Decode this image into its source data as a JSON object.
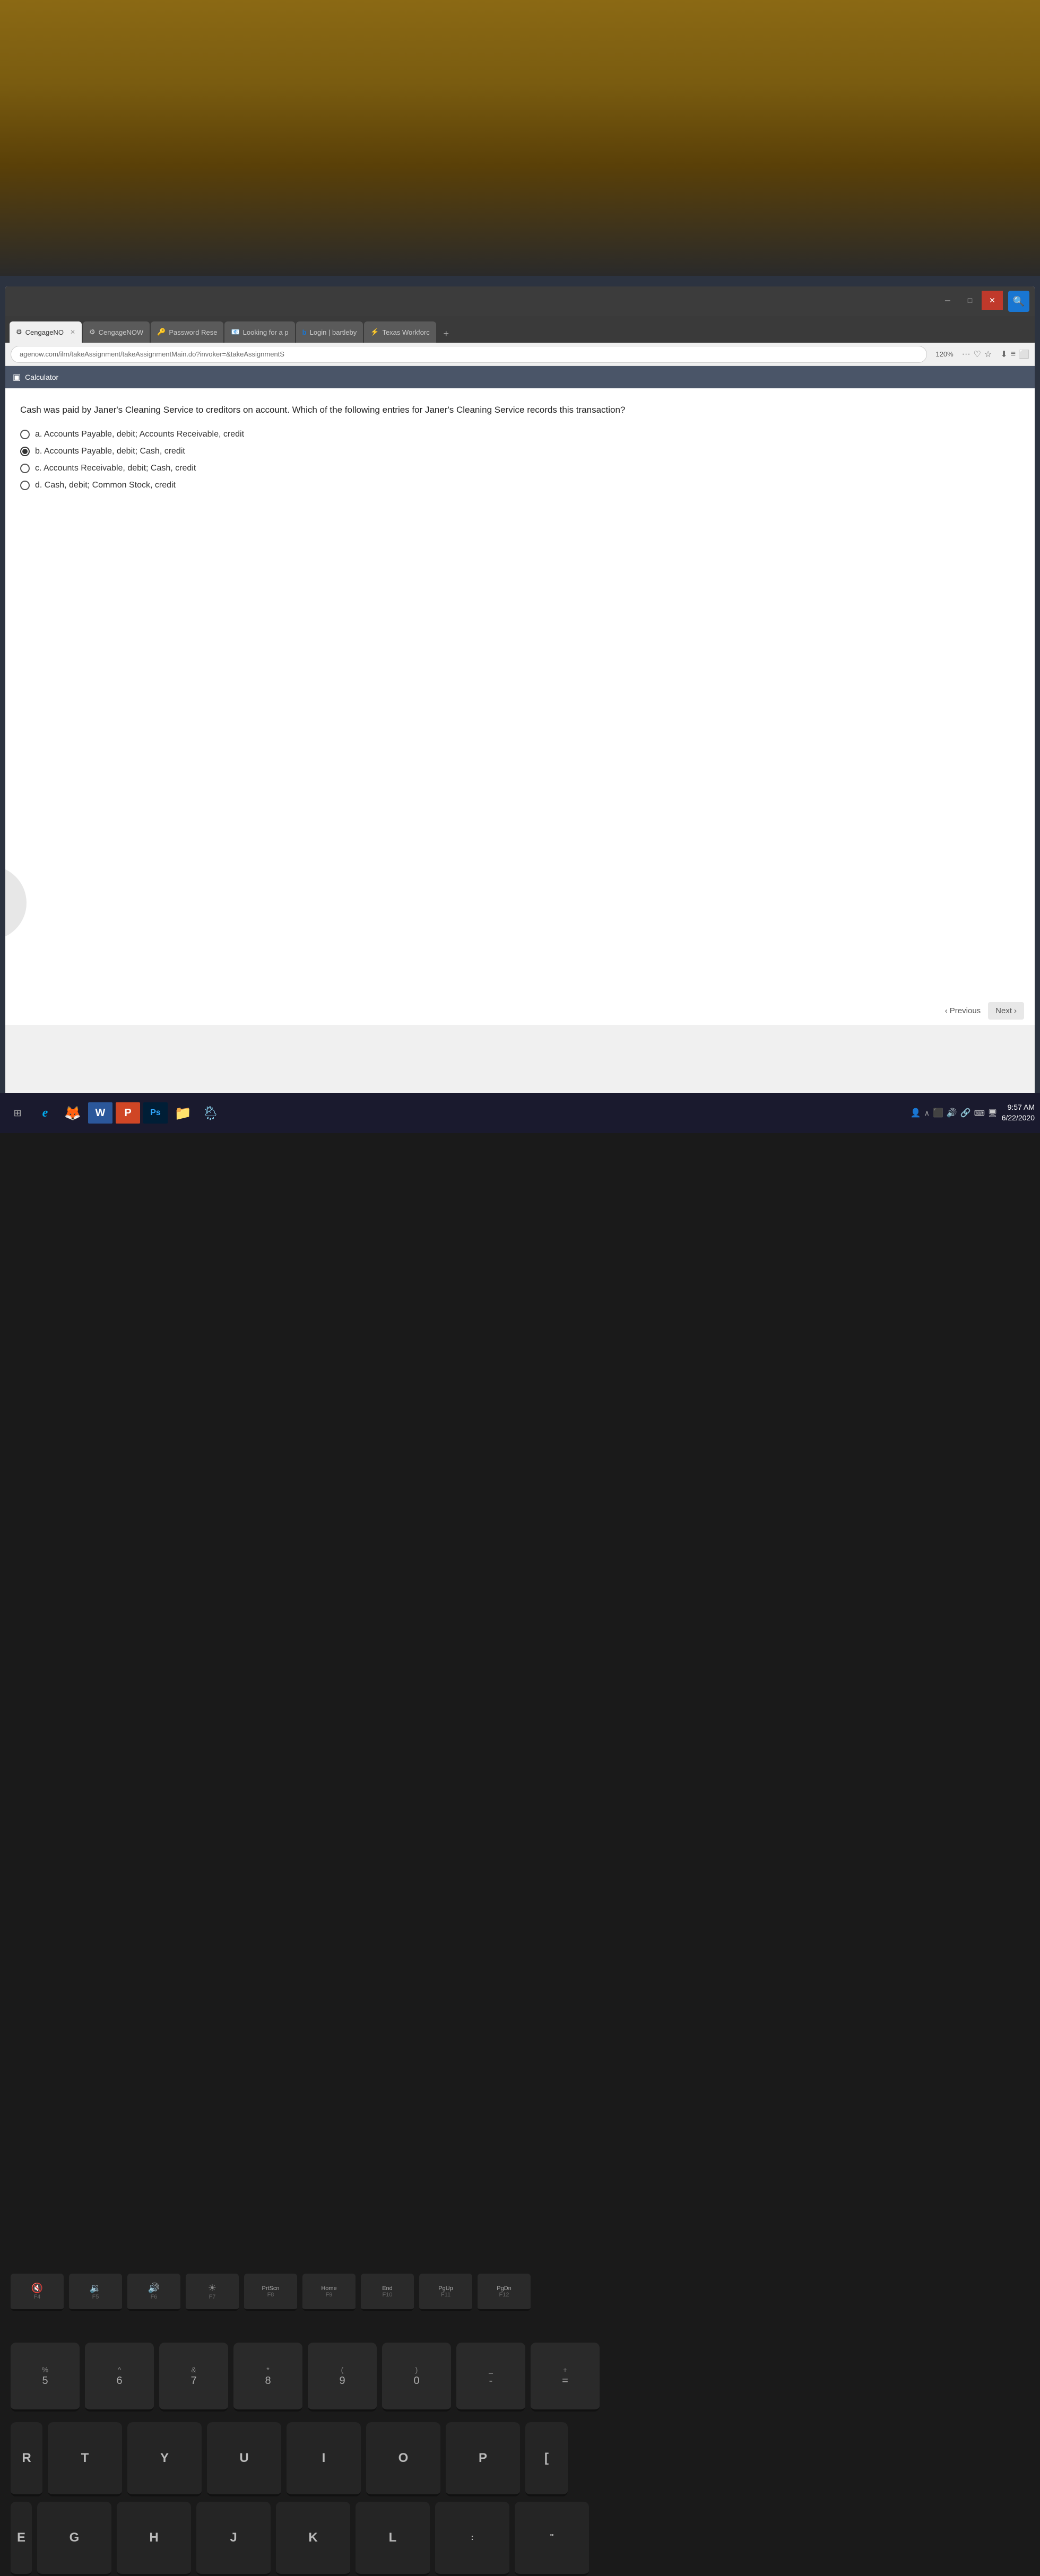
{
  "background": {
    "chair_color": "#8B6914"
  },
  "browser": {
    "tabs": [
      {
        "id": "tab1",
        "label": "CengageNO",
        "active": true,
        "icon": "⚙️"
      },
      {
        "id": "tab2",
        "label": "CengageNOW",
        "active": false,
        "icon": "⚙️"
      },
      {
        "id": "tab3",
        "label": "Password Rese",
        "active": false,
        "icon": "🔑"
      },
      {
        "id": "tab4",
        "label": "Looking for a p",
        "active": false,
        "icon": "📧"
      },
      {
        "id": "tab5",
        "label": "Login | bartleby",
        "active": false,
        "icon": "b"
      },
      {
        "id": "tab6",
        "label": "Texas Workforc",
        "active": false,
        "icon": "⚡"
      }
    ],
    "address_bar": {
      "url": "agenow.com/ilrn/takeAssignment/takeAssignmentMain.do?invoker=&takeAssignmentS",
      "zoom": "120%"
    }
  },
  "toolbar": {
    "calculator_label": "Calculator"
  },
  "question": {
    "text": "Cash was paid by Janer's Cleaning Service to creditors on account. Which of the following entries for Janer's Cleaning Service records this transaction?",
    "options": [
      {
        "id": "a",
        "label": "a. Accounts Payable, debit; Accounts Receivable, credit",
        "selected": false
      },
      {
        "id": "b",
        "label": "b. Accounts Payable, debit; Cash, credit",
        "selected": true
      },
      {
        "id": "c",
        "label": "c. Accounts Receivable, debit; Cash, credit",
        "selected": false
      },
      {
        "id": "d",
        "label": "d. Cash, debit; Common Stock, credit",
        "selected": false
      }
    ]
  },
  "navigation": {
    "previous_label": "Previous",
    "next_label": "Next"
  },
  "taskbar": {
    "icons": [
      {
        "id": "view",
        "symbol": "⊞",
        "label": "Task View"
      },
      {
        "id": "ie",
        "symbol": "e",
        "label": "Internet Explorer"
      },
      {
        "id": "firefox",
        "symbol": "🦊",
        "label": "Firefox"
      },
      {
        "id": "word",
        "symbol": "W",
        "label": "Word"
      },
      {
        "id": "ppt",
        "symbol": "P",
        "label": "PowerPoint"
      },
      {
        "id": "ps",
        "symbol": "Ps",
        "label": "Photoshop"
      },
      {
        "id": "folder",
        "symbol": "📁",
        "label": "File Explorer"
      },
      {
        "id": "weather",
        "symbol": "🌦",
        "label": "Weather"
      }
    ],
    "time": "9:57 AM",
    "date": "6/22/2020"
  },
  "keyboard": {
    "fn_row": [
      "F4: mute",
      "F5: vol-",
      "F6: vol+",
      "F7: brightness",
      "F8: PrtScn",
      "F9: Home",
      "F10: End",
      "F11: PgUp",
      "F12: PgDn"
    ],
    "number_row": [
      {
        "top": "%",
        "bottom": "5"
      },
      {
        "top": "^",
        "bottom": "6"
      },
      {
        "top": "&",
        "bottom": "7"
      },
      {
        "top": "*",
        "bottom": "8"
      },
      {
        "top": "(",
        "bottom": "9"
      },
      {
        "top": ")",
        "bottom": "0"
      },
      {
        "top": "_",
        "bottom": "-"
      },
      {
        "top": "+",
        "bottom": "="
      }
    ],
    "qwerty_row": [
      "T",
      "Y",
      "U",
      "I",
      "O",
      "P",
      "["
    ],
    "asdf_row": [
      "G",
      "H",
      "J",
      "K",
      "L"
    ],
    "left_partial": [
      "R",
      "E"
    ]
  }
}
